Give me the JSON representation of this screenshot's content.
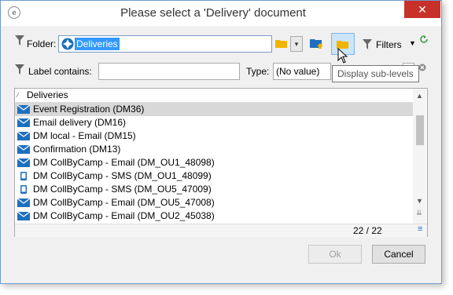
{
  "window": {
    "title": "Please select a 'Delivery' document",
    "close_glyph": "✕"
  },
  "toolbar": {
    "folder_label": "Folder:",
    "folder_value": "Deliveries",
    "filters_label": "Filters",
    "label_contains": "Label contains:",
    "label_value": "",
    "type_label": "Type:",
    "type_value": "(No value)"
  },
  "tooltip": "Display sub-levels",
  "list": {
    "header": "Deliveries",
    "items": [
      {
        "label": "Event Registration (DM36)",
        "icon": "email-icon",
        "selected": true
      },
      {
        "label": "Email delivery (DM16)",
        "icon": "email-icon"
      },
      {
        "label": "DM local - Email (DM15)",
        "icon": "email-icon"
      },
      {
        "label": "Confirmation (DM13)",
        "icon": "email-icon"
      },
      {
        "label": "DM CollByCamp - Email (DM_OU1_48098)",
        "icon": "email-icon"
      },
      {
        "label": "DM CollByCamp - SMS (DM_OU1_48099)",
        "icon": "mobile-icon"
      },
      {
        "label": "DM CollByCamp - SMS (DM_OU5_47009)",
        "icon": "mobile-icon"
      },
      {
        "label": "DM CollByCamp - Email (DM_OU5_47008)",
        "icon": "email-icon"
      },
      {
        "label": "DM CollByCamp - Email (DM_OU2_45038)",
        "icon": "email-icon"
      }
    ],
    "count": "22 / 22"
  },
  "buttons": {
    "ok": "Ok",
    "cancel": "Cancel"
  },
  "colors": {
    "accent": "#3399ff",
    "close": "#c7312a",
    "icon_blue": "#1f6fbf",
    "folder_yellow": "#f0b400"
  }
}
